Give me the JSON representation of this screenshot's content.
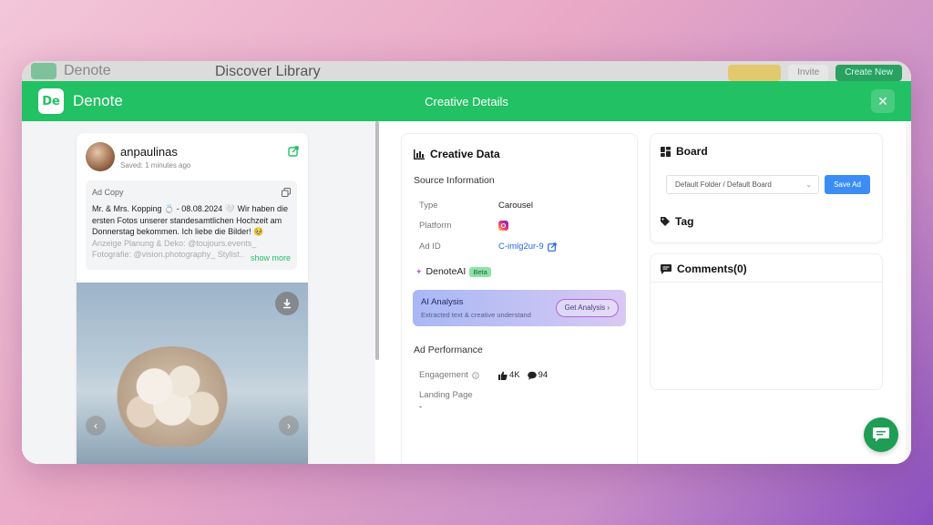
{
  "background_app": {
    "brand": "Denote",
    "title": "Discover Library",
    "buttons": [
      "Invite",
      "Create New"
    ]
  },
  "header": {
    "logo_text": "De",
    "brand": "Denote",
    "title": "Creative Details",
    "close": "✕"
  },
  "ad_card": {
    "username": "anpaulinas",
    "saved": "Saved: 1 minutes ago",
    "ad_copy_label": "Ad Copy",
    "ad_copy_text": "Mr. & Mrs. Kopping 💍 - 08.08.2024 🤍 Wir haben die ersten Fotos unserer standesamtlichen Hochzeit am Donnerstag bekommen. Ich liebe die Bilder! 🥹",
    "ad_copy_faded": "Anzeige Planung & Deko: @toujours.events_ Fotografie: @vision.photography_ Stylist...",
    "show_more": "show more"
  },
  "creative_data": {
    "title": "Creative Data",
    "source_heading": "Source Information",
    "fields": [
      {
        "key": "Type",
        "value": "Carousel"
      },
      {
        "key": "Platform",
        "value": ""
      },
      {
        "key": "Ad ID",
        "value": "C-imlg2ur-9"
      }
    ],
    "denote_ai": "DenoteAI",
    "beta": "Beta",
    "ai_analysis": {
      "title": "AI Analysis",
      "subtitle": "Extracted text & creative understand",
      "button": "Get Analysis"
    },
    "performance_heading": "Ad Performance",
    "engagement_label": "Engagement",
    "likes": "4K",
    "comments": "94",
    "landing_label": "Landing Page",
    "landing_value": "-"
  },
  "board": {
    "title": "Board",
    "select_value": "Default Folder / Default Board",
    "save_button": "Save Ad",
    "tag_title": "Tag"
  },
  "comments": {
    "title": "Comments(0)"
  },
  "colors": {
    "brand_green": "#22c164",
    "save_blue": "#3b8df5",
    "link_blue": "#2563eb"
  }
}
